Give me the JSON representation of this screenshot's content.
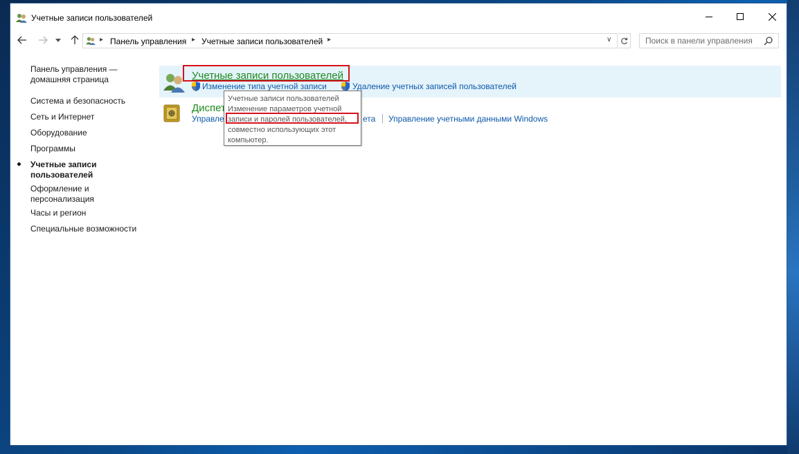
{
  "window": {
    "title": "Учетные записи пользователей"
  },
  "nav": {
    "breadcrumbs": [
      "Панель управления",
      "Учетные записи пользователей"
    ],
    "search_placeholder": "Поиск в панели управления"
  },
  "sidebar": {
    "items": [
      {
        "label_line1": "Панель управления —",
        "label_line2": "домашняя страница"
      },
      {
        "label_line1": "Система и безопасность"
      },
      {
        "label_line1": "Сеть и Интернет"
      },
      {
        "label_line1": "Оборудование"
      },
      {
        "label_line1": "Программы"
      },
      {
        "label_line1": "Учетные записи",
        "label_line2": "пользователей",
        "active": true
      },
      {
        "label_line1": "Оформление и",
        "label_line2": "персонализация"
      },
      {
        "label_line1": "Часы и регион"
      },
      {
        "label_line1": "Специальные возможности"
      }
    ]
  },
  "categories": [
    {
      "title": "Учетные записи пользователей",
      "links": [
        "Изменение типа учетной записи",
        "Удаление учетных записей пользователей"
      ]
    },
    {
      "title": "Диспет",
      "links": [
        "Управле",
        "ета",
        "Управление учетными данными Windows"
      ]
    }
  ],
  "tooltip": {
    "lines": [
      "Учетные записи пользователей",
      "Изменение параметров учетной",
      "записи и паролей пользователей,",
      "совместно использующих этот",
      "компьютер."
    ]
  },
  "colors": {
    "accent_green": "#1e8a1e",
    "link_blue": "#0c58a8",
    "highlight_red": "#d7101b",
    "category_hover_bg": "#e5f3fb"
  },
  "icons": {
    "title": "users-icon",
    "back": "arrow-left-icon",
    "forward": "arrow-right-icon",
    "up": "arrow-up-icon",
    "refresh": "refresh-icon",
    "search": "search-icon",
    "task": "uac-shield-icon",
    "credential": "safe-icon"
  }
}
